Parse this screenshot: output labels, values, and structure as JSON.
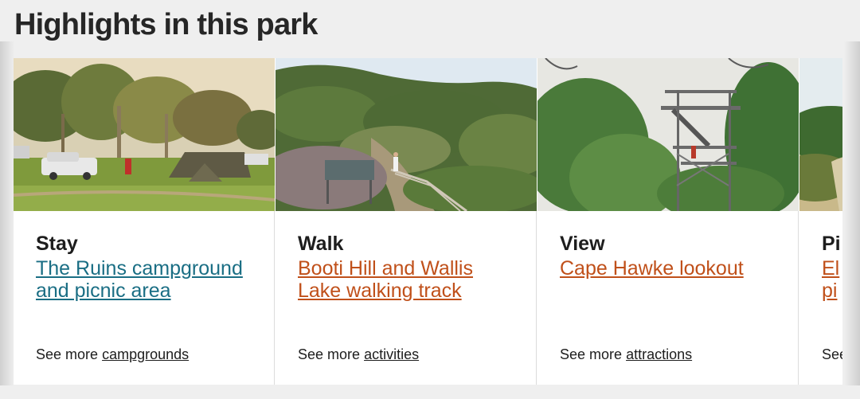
{
  "heading": "Highlights in this park",
  "cards": [
    {
      "category": "Stay",
      "title": "The Ruins campground and picnic area",
      "title_color": "#1a6e84",
      "more_prefix": "See more",
      "more_link": "campgrounds",
      "image": "campground-photo"
    },
    {
      "category": "Walk",
      "title": "Booti Hill and Wallis Lake walking track",
      "title_color": "#c0501a",
      "more_prefix": "See more",
      "more_link": "activities",
      "image": "walking-track-photo"
    },
    {
      "category": "View",
      "title": "Cape Hawke lookout",
      "title_color": "#c0501a",
      "more_prefix": "See more",
      "more_link": "attractions",
      "image": "lookout-tower-photo"
    },
    {
      "category": "Pi",
      "title": "El\npi",
      "title_color": "#c0501a",
      "more_prefix": "See",
      "more_link": "",
      "image": "beach-photo"
    }
  ]
}
